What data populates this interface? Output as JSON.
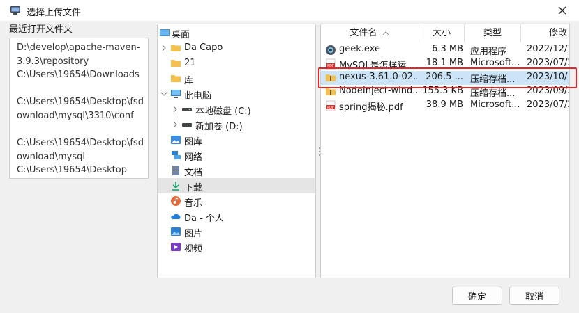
{
  "window": {
    "title": "选择上传文件",
    "icon": "window-icon"
  },
  "recent": {
    "label": "最近打开文件夹",
    "items": [
      "D:\\develop\\apache-maven-3.9.3\\repository",
      "C:\\Users\\19654\\Downloads",
      "C:\\Users\\19654\\Desktop\\fsdownload\\mysql\\3310\\conf",
      "C:\\Users\\19654\\Desktop\\fsdownload\\mysql",
      "C:\\Users\\19654\\Desktop"
    ]
  },
  "tree": {
    "items": [
      {
        "label": "桌面",
        "icon": "desktop-icon"
      },
      {
        "label": "Da Capo",
        "icon": "folder-icon"
      },
      {
        "label": "21",
        "icon": "folder-icon"
      },
      {
        "label": "库",
        "icon": "folder-icon"
      },
      {
        "label": "此电脑",
        "icon": "computer-icon"
      },
      {
        "label": "本地磁盘 (C:)",
        "icon": "drive-icon"
      },
      {
        "label": "新加卷 (D:)",
        "icon": "drive-icon"
      },
      {
        "label": "图库",
        "icon": "gallery-icon"
      },
      {
        "label": "网络",
        "icon": "network-icon"
      },
      {
        "label": "文档",
        "icon": "documents-icon"
      },
      {
        "label": "下载",
        "icon": "download-icon"
      },
      {
        "label": "音乐",
        "icon": "music-icon"
      },
      {
        "label": "Da - 个人",
        "icon": "onedrive-icon"
      },
      {
        "label": "图片",
        "icon": "pictures-icon"
      },
      {
        "label": "视频",
        "icon": "videos-icon"
      }
    ]
  },
  "files": {
    "columns": [
      "文件名",
      "大小",
      "类型",
      "修改"
    ],
    "rows": [
      {
        "name": "geek.exe",
        "size": "6.3 MB",
        "type": "应用程序",
        "modified": "2022/12/1",
        "icon": "exe-icon"
      },
      {
        "name": "MySQL是怎样运...",
        "size": "18.1 MB",
        "type": "Microsoft...",
        "modified": "2023/07/2",
        "icon": "pdf-icon"
      },
      {
        "name": "nexus-3.61.0-02...",
        "size": "206.5 ...",
        "type": "压缩存档...",
        "modified": "2023/10/",
        "icon": "zip-icon"
      },
      {
        "name": "NodeInject-wind...",
        "size": "155.3 KB",
        "type": "压缩存档...",
        "modified": "2023/09/2",
        "icon": "zip-icon"
      },
      {
        "name": "spring揭秘.pdf",
        "size": "38.9 MB",
        "type": "Microsoft...",
        "modified": "2023/07/2",
        "icon": "pdf-icon"
      }
    ]
  },
  "buttons": {
    "ok": "确定",
    "cancel": "取消"
  },
  "colors": {
    "selection": "#cce4f7",
    "highlight": "#e3262b",
    "folder": "#f4c04f"
  }
}
